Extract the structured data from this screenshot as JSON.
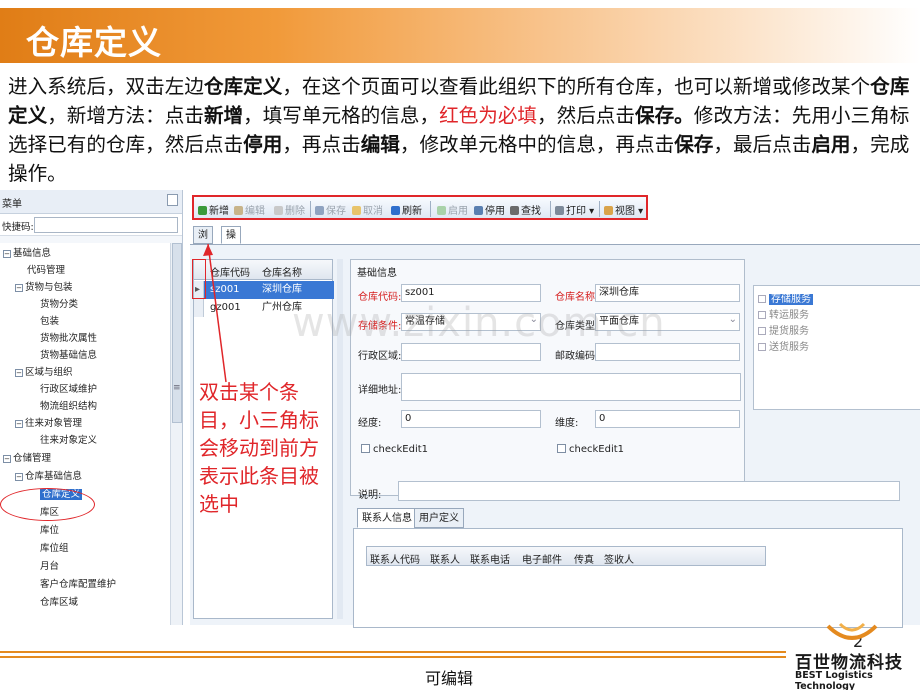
{
  "title": "仓库定义",
  "paragraph": {
    "p1": "进入系统后，双击左边",
    "b1": "仓库定义",
    "p2": "，在这个页面可以查看此组织下的所有仓库，也可以新增或修改某个",
    "b2": "仓库定义",
    "p3": "，新增方法：点击",
    "b3": "新增",
    "p4": "，填写单元格的信息，",
    "red": "红色为必填",
    "p5": "，然后点击",
    "b4": "保存。",
    "p6": "修改方法：先用小三角标选择已有的仓库，然后点击",
    "b5": "停用",
    "p7": "，再点击",
    "b6": "编辑",
    "p8": "，修改单元格中的信息，再点击",
    "b7": "保存",
    "p9": "，最后点击",
    "b8": "启用",
    "p10": "，完成操作。"
  },
  "tree": {
    "header": "菜单",
    "quick_label": "快捷码:",
    "items": [
      "基础信息",
      "代码管理",
      "货物与包装",
      "货物分类",
      "包装",
      "货物批次属性",
      "货物基础信息",
      "区域与组织",
      "行政区域维护",
      "物流组织结构",
      "往来对象管理",
      "往来对象定义",
      "仓储管理",
      "仓库基础信息",
      "仓库定义",
      "库区",
      "库位",
      "库位组",
      "月台",
      "客户仓库配置维护",
      "仓库区域"
    ]
  },
  "toolbar": {
    "add": "新增",
    "edit": "编辑",
    "delete": "删除",
    "save": "保存",
    "cancel": "取消",
    "refresh": "刷新",
    "enable": "启用",
    "disable": "停用",
    "find": "查找",
    "print": "打印",
    "view": "视图"
  },
  "tabs": {
    "browse": "浏览",
    "operate": "操作"
  },
  "grid": {
    "col_code": "仓库代码",
    "col_name": "仓库名称",
    "rows": [
      {
        "code": "sz001",
        "name": "深圳仓库"
      },
      {
        "code": "gz001",
        "name": "广州仓库"
      }
    ]
  },
  "form": {
    "section": "基础信息",
    "code_label": "仓库代码:",
    "code_value": "sz001",
    "name_label": "仓库名称:",
    "name_value": "深圳仓库",
    "cond_label": "存储条件:",
    "cond_value": "常温存储",
    "type_label": "仓库类型:",
    "type_value": "平面仓库",
    "region_label": "行政区域:",
    "zip_label": "邮政编码:",
    "addr_label": "详细地址:",
    "lng_label": "经度:",
    "lng_value": "0",
    "lat_label": "维度:",
    "lat_value": "0",
    "chk1": "checkEdit1",
    "chk2": "checkEdit1",
    "note_label": "说明:"
  },
  "services": [
    "存储服务",
    "转运服务",
    "提货服务",
    "送货服务"
  ],
  "lower_tabs": {
    "contacts": "联系人信息",
    "custom": "用户定义"
  },
  "contact_cols": [
    "联系人代码",
    "联系人",
    "联系电话",
    "电子邮件",
    "传真",
    "签收人"
  ],
  "callout": "双击某个条目，小三角标会移动到前方表示此条目被选中",
  "watermark": "www.zixin.com.cn",
  "footer": {
    "page": "2",
    "editable": "可编辑",
    "logo_cn": "百世物流科技",
    "logo_en": "BEST Logistics Technology"
  },
  "colors": {
    "accent": "#e48a1f",
    "alert": "#e0262a",
    "selection": "#3a78d4"
  }
}
